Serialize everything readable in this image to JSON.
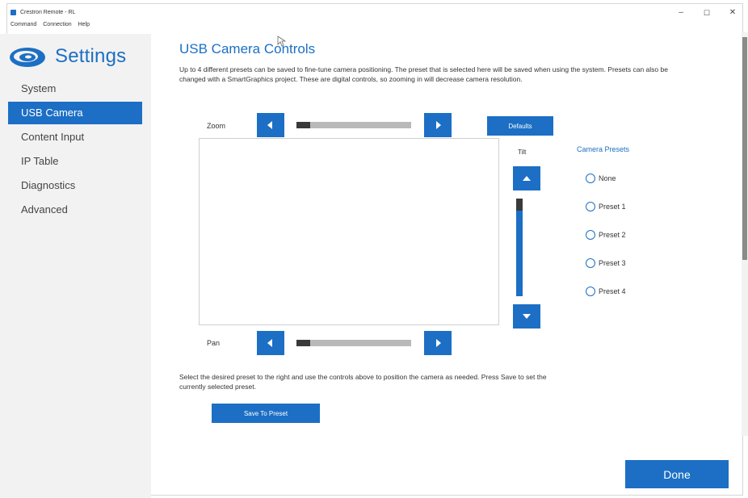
{
  "window": {
    "title": "Crestron Remote - RL",
    "menu": [
      "Command",
      "Connection",
      "Help"
    ],
    "controls": {
      "minimize": "–",
      "maximize": "☐",
      "close": "✕"
    }
  },
  "sidebar": {
    "title": "Settings",
    "items": [
      {
        "label": "System"
      },
      {
        "label": "USB Camera"
      },
      {
        "label": "Content Input"
      },
      {
        "label": "IP Table"
      },
      {
        "label": "Diagnostics"
      },
      {
        "label": "Advanced"
      }
    ],
    "active_item": "USB Camera"
  },
  "main": {
    "heading": "USB Camera Controls",
    "description": "Up to 4 different presets can be saved to fine-tune camera positioning.  The preset that is selected here will be saved when using the system.  Presets can also be changed with a SmartGraphics project.  These are digital controls, so zooming in will decrease camera resolution.",
    "zoom": {
      "label": "Zoom",
      "value_fraction": 0.12
    },
    "pan": {
      "label": "Pan",
      "value_fraction": 0.12
    },
    "tilt": {
      "label": "Tilt",
      "value_fraction": 0.12
    },
    "defaults_button": "Defaults",
    "presets": {
      "title": "Camera Presets",
      "options": [
        "None",
        "Preset 1",
        "Preset 2",
        "Preset 3",
        "Preset 4"
      ]
    },
    "instructions": "Select the desired preset to the right and use the controls above to position the camera as needed.  Press Save to set the currently selected preset.",
    "save_button": "Save To Preset",
    "done_button": "Done"
  },
  "colors": {
    "accent": "#1c6fc4",
    "slider_track": "#b9b9b9",
    "slider_fill": "#3a3a3a",
    "sidebar_bg": "#f2f2f2"
  }
}
